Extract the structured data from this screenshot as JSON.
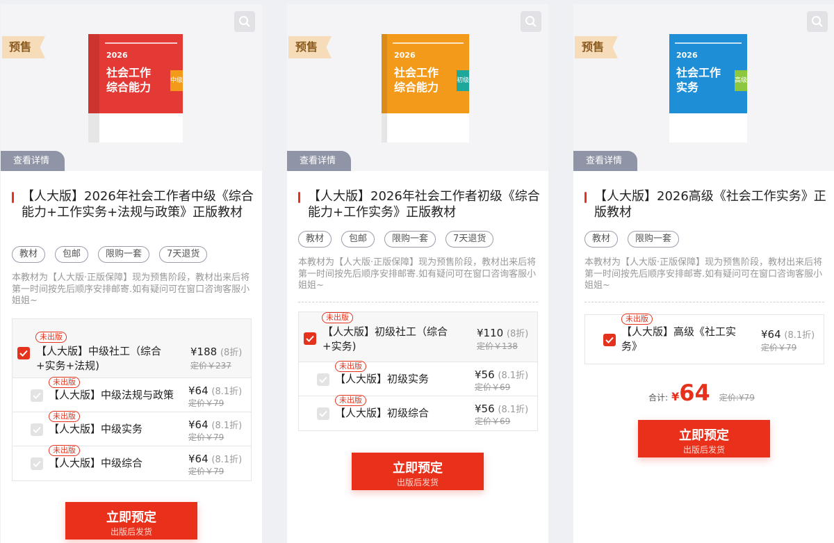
{
  "common": {
    "presale_label": "预售",
    "detail_label": "查看详情",
    "badge_label": "未出版",
    "discount_suffix_8": "(8折)",
    "discount_suffix_81": "(8.1折)",
    "btn_main": "立即预定",
    "btn_sub": "出版后发货",
    "total_label": "合计:",
    "currency": "¥"
  },
  "books": {
    "year": "2026",
    "zh_title_1": "社会工作",
    "zh_title_2": "综合能力",
    "zh_title_3": "实务",
    "tag_mid": "中级",
    "tag_low": "初级",
    "tag_high": "高级"
  },
  "cards": [
    {
      "title": "【人大版】2026年社会工作者中级《综合能力+工作实务+法规与政策》正版教材",
      "tags": [
        "教材",
        "包邮",
        "限购一套",
        "7天退货"
      ],
      "desc": "本教材为【人大版·正版保障】现为预售阶段，教材出来后将第一时间按先后顺序安排邮寄.如有疑问可在窗口咨询客服小姐姐~",
      "options": [
        {
          "name": "【人大版】中级社工（综合+实务+法规)",
          "price": "¥188",
          "orig": "定价￥237"
        },
        {
          "name": "【人大版】中级法规与政策",
          "price": "¥64",
          "orig": "定价￥79"
        },
        {
          "name": "【人大版】中级实务",
          "price": "¥64",
          "orig": "定价￥79"
        },
        {
          "name": "【人大版】中级综合",
          "price": "¥64",
          "orig": "定价￥79"
        }
      ]
    },
    {
      "title": "【人大版】2026年社会工作者初级《综合能力+工作实务》正版教材",
      "tags": [
        "教材",
        "包邮",
        "限购一套",
        "7天退货"
      ],
      "desc": "本教材为【人大版·正版保障】现为预售阶段，教材出来后将第一时间按先后顺序安排邮寄.如有疑问可在窗口咨询客服小姐姐~",
      "options": [
        {
          "name": "【人大版】初级社工（综合+实务)",
          "price": "¥110",
          "orig": "定价￥138"
        },
        {
          "name": "【人大版】初级实务",
          "price": "¥56",
          "orig": "定价￥69"
        },
        {
          "name": "【人大版】初级综合",
          "price": "¥56",
          "orig": "定价￥69"
        }
      ]
    },
    {
      "title": "【人大版】2026高级《社会工作实务》正版教材",
      "tags": [
        "教材",
        "限购一套"
      ],
      "desc": "本教材为【人大版·正版保障】现为预售阶段，教材出来后将第一时间按先后顺序安排邮寄.如有疑问可在窗口咨询客服小姐姐~",
      "options": [
        {
          "name": "【人大版】高级《社工实务》",
          "price": "¥64",
          "orig": "定价￥79"
        }
      ],
      "total_amount": "64",
      "total_orig": "定价:¥79"
    }
  ],
  "colors": {
    "accent": "#e5321c",
    "book_red": "#e33a35",
    "book_orange": "#f39a1b",
    "book_blue": "#1e8fd6"
  }
}
